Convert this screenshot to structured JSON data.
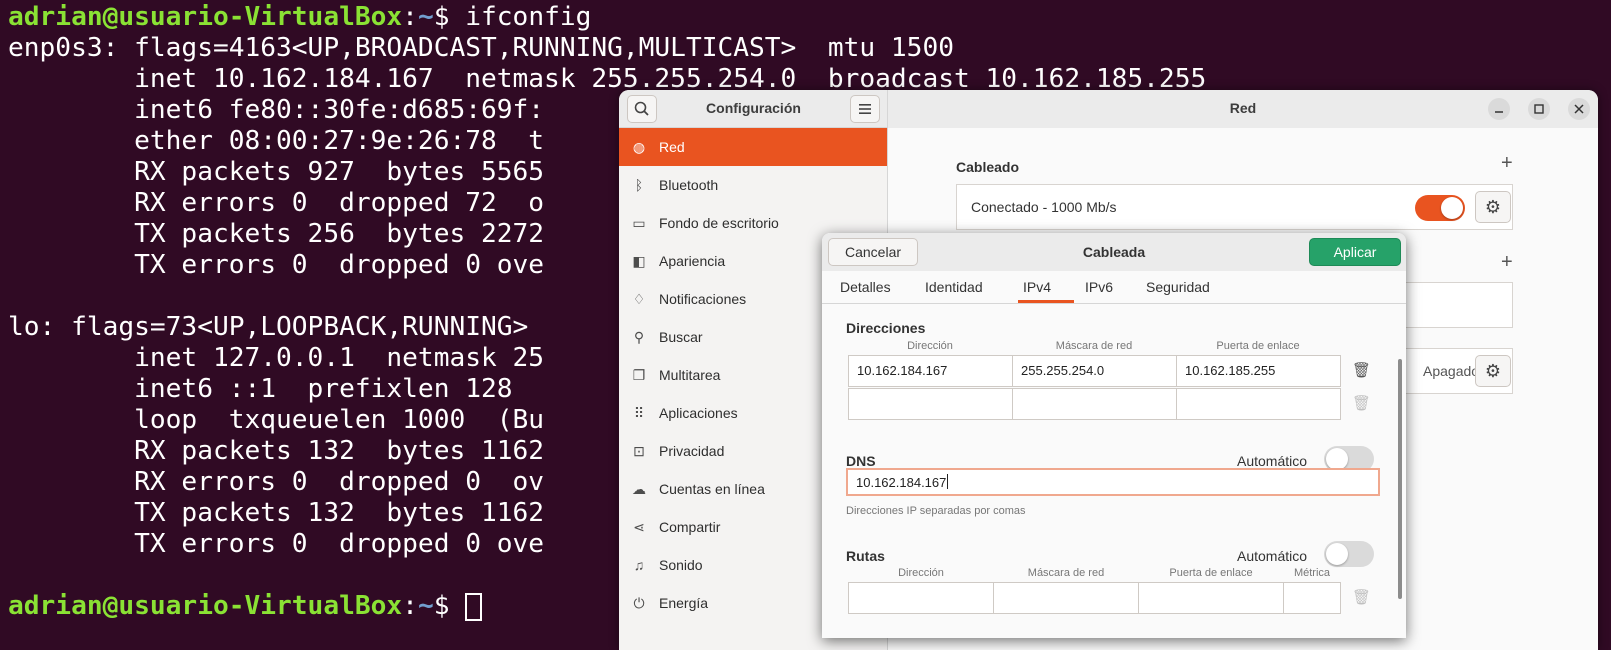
{
  "terminal": {
    "lines": [
      {
        "type": "prompt",
        "user": "adrian@usuario-VirtualBox",
        "sep": ":",
        "path": "~",
        "symbol": "$ ",
        "cmd": "ifconfig"
      },
      {
        "type": "text",
        "text": "enp0s3: flags=4163<UP,BROADCAST,RUNNING,MULTICAST>  mtu 1500"
      },
      {
        "type": "text",
        "text": "        inet 10.162.184.167  netmask 255.255.254.0  broadcast 10.162.185.255"
      },
      {
        "type": "text",
        "text": "        inet6 fe80::30fe:d685:69f:"
      },
      {
        "type": "text",
        "text": "        ether 08:00:27:9e:26:78  t"
      },
      {
        "type": "text",
        "text": "        RX packets 927  bytes 5565"
      },
      {
        "type": "text",
        "text": "        RX errors 0  dropped 72  o"
      },
      {
        "type": "text",
        "text": "        TX packets 256  bytes 2272"
      },
      {
        "type": "text",
        "text": "        TX errors 0  dropped 0 ove"
      },
      {
        "type": "text",
        "text": ""
      },
      {
        "type": "text",
        "text": "lo: flags=73<UP,LOOPBACK,RUNNING>"
      },
      {
        "type": "text",
        "text": "        inet 127.0.0.1  netmask 25"
      },
      {
        "type": "text",
        "text": "        inet6 ::1  prefixlen 128"
      },
      {
        "type": "text",
        "text": "        loop  txqueuelen 1000  (Bu"
      },
      {
        "type": "text",
        "text": "        RX packets 132  bytes 1162"
      },
      {
        "type": "text",
        "text": "        RX errors 0  dropped 0  ov"
      },
      {
        "type": "text",
        "text": "        TX packets 132  bytes 1162"
      },
      {
        "type": "text",
        "text": "        TX errors 0  dropped 0 ove"
      },
      {
        "type": "text",
        "text": ""
      },
      {
        "type": "prompt",
        "user": "adrian@usuario-VirtualBox",
        "sep": ":",
        "path": "~",
        "symbol": "$ ",
        "cmd": "",
        "cursor": true
      }
    ]
  },
  "settings": {
    "sidebar_title": "Configuración",
    "main_title": "Red",
    "sidebar_items": [
      {
        "label": "Red",
        "icon": "globe-icon",
        "glyph": "◍",
        "active": true
      },
      {
        "label": "Bluetooth",
        "icon": "bluetooth-icon",
        "glyph": "ᛒ",
        "active": false
      },
      {
        "label": "Fondo de escritorio",
        "icon": "monitor-icon",
        "glyph": "▭",
        "active": false
      },
      {
        "label": "Apariencia",
        "icon": "appearance-icon",
        "glyph": "◧",
        "active": false
      },
      {
        "label": "Notificaciones",
        "icon": "bell-icon",
        "glyph": "♢",
        "active": false
      },
      {
        "label": "Buscar",
        "icon": "search-icon",
        "glyph": "⚲",
        "active": false
      },
      {
        "label": "Multitarea",
        "icon": "multitask-icon",
        "glyph": "❐",
        "active": false
      },
      {
        "label": "Aplicaciones",
        "icon": "grid-icon",
        "glyph": "⠿",
        "active": false
      },
      {
        "label": "Privacidad",
        "icon": "lock-icon",
        "glyph": "⊡",
        "active": false
      },
      {
        "label": "Cuentas en línea",
        "icon": "cloud-icon",
        "glyph": "☁",
        "active": false
      },
      {
        "label": "Compartir",
        "icon": "share-icon",
        "glyph": "⋖",
        "active": false
      },
      {
        "label": "Sonido",
        "icon": "music-icon",
        "glyph": "♫",
        "active": false
      },
      {
        "label": "Energía",
        "icon": "power-icon",
        "glyph": "⏻",
        "active": false
      }
    ],
    "wired_section": "Cableado",
    "wired_status": "Conectado - 1000 Mb/s",
    "vpn_status": "Apagado"
  },
  "dialog": {
    "title": "Cableada",
    "cancel_label": "Cancelar",
    "apply_label": "Aplicar",
    "tabs": [
      "Detalles",
      "Identidad",
      "IPv4",
      "IPv6",
      "Seguridad"
    ],
    "active_tab": "IPv4",
    "addresses": {
      "title": "Direcciones",
      "headers": [
        "Dirección",
        "Máscara de red",
        "Puerta de enlace"
      ],
      "rows": [
        [
          "10.162.184.167",
          "255.255.254.0",
          "10.162.185.255"
        ],
        [
          "",
          "",
          ""
        ]
      ]
    },
    "dns": {
      "title": "DNS",
      "auto_label": "Automático",
      "value": "10.162.184.167",
      "hint": "Direcciones IP separadas por comas"
    },
    "routes": {
      "title": "Rutas",
      "auto_label": "Automático",
      "headers": [
        "Dirección",
        "Máscara de red",
        "Puerta de enlace",
        "Métrica"
      ]
    }
  },
  "colors": {
    "accent": "#e95420",
    "apply": "#26a269",
    "terminal_bg": "#300a24"
  }
}
